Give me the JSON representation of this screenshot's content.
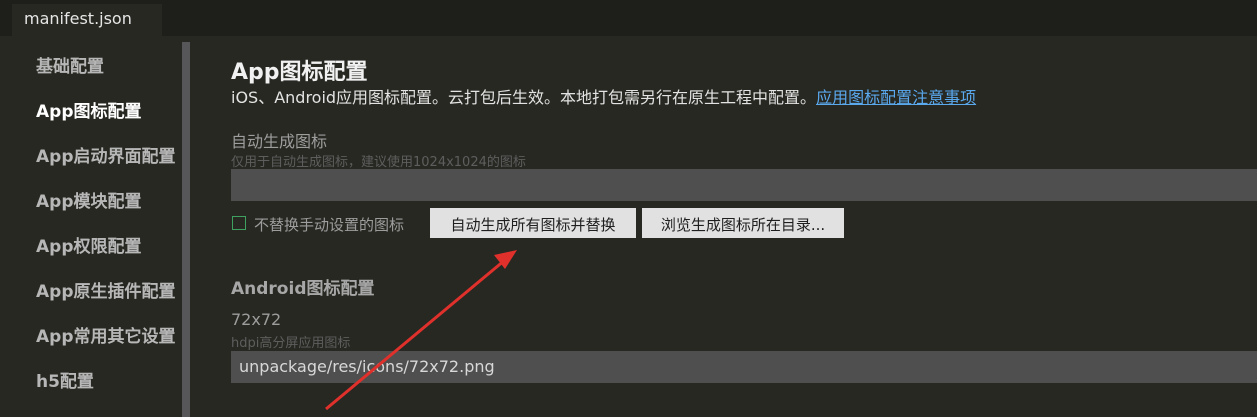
{
  "tabs": [
    {
      "label": "manifest.json"
    }
  ],
  "sidebar": {
    "items": [
      {
        "label": "基础配置"
      },
      {
        "label": "App图标配置"
      },
      {
        "label": "App启动界面配置"
      },
      {
        "label": "App模块配置"
      },
      {
        "label": "App权限配置"
      },
      {
        "label": "App原生插件配置"
      },
      {
        "label": "App常用其它设置"
      },
      {
        "label": "h5配置"
      }
    ]
  },
  "main": {
    "title": "App图标配置",
    "description": "iOS、Android应用图标配置。云打包后生效。本地打包需另行在原生工程中配置。",
    "description_link": "应用图标配置注意事项",
    "auto": {
      "label": "自动生成图标",
      "hint": "仅用于自动生成图标，建议使用1024x1024的图标",
      "value": ""
    },
    "checkbox_label": "不替换手动设置的图标",
    "generate_button": "自动生成所有图标并替换",
    "browse_button": "浏览生成图标所在目录...",
    "android_section": "Android图标配置",
    "size72": {
      "label": "72x72",
      "hint": "hdpi高分屏应用图标",
      "value": "unpackage/res/icons/72x72.png"
    }
  },
  "colors": {
    "background": "#272822",
    "link": "#5aa8ee",
    "arrow": "#e0302b",
    "checkbox": "#3fa15f"
  }
}
